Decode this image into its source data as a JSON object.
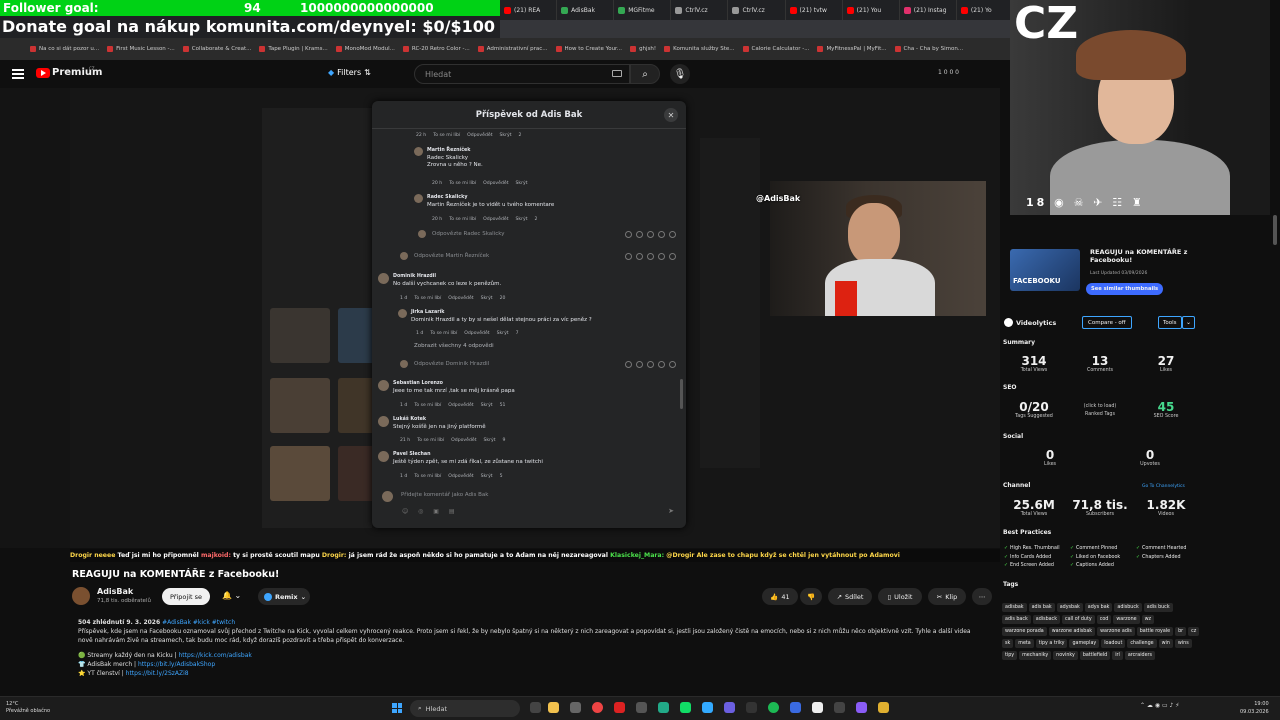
{
  "overlay": {
    "goal_label": "Follower goal:",
    "goal_current": "94",
    "goal_target": "1000000000000000",
    "donate_text": "Donate goal na nákup komunita.com/deynyel: $0/$100",
    "cam_text": "CZ"
  },
  "browser": {
    "tabs": [
      "(21) REA",
      "AdisBak",
      "MGFitme",
      "CtrlV.cz",
      "CtrlV.cz",
      "(21) tvtw",
      "(21) You",
      "(21) Instag",
      "(21) Yo"
    ],
    "tab_colors": [
      "#ff0000",
      "#34a853",
      "#34a853",
      "#999999",
      "#999999",
      "#ff0000",
      "#ff0000",
      "#e1306c",
      "#ff0000"
    ],
    "bookmarks": [
      "Na co si dát pozor u...",
      "First Music Lesson -...",
      "Collaborate & Creat...",
      "Tape Plugin | Krams...",
      "MonoMod Modul...",
      "RC-20 Retro Color -...",
      "Administrativní prac...",
      "How to Create Your...",
      "ghjsh!",
      "Komunita služby Ste...",
      "Calorie Calculator -...",
      "MyFitnessPal | MyFit...",
      "Cha - Cha by Simon..."
    ]
  },
  "yt_header": {
    "brand": "Premium",
    "country": "CZ",
    "filters_label": "Filters",
    "search_placeholder": "Hledat",
    "counts": "1 0 0 0"
  },
  "modal": {
    "title": "Příspěvek od Adis Bak",
    "comments": [
      {
        "meta": [
          "22 h",
          "To se mi líbí",
          "Odpovědět",
          "Skrýt",
          "2"
        ]
      },
      {
        "author": "Martin Řezníček",
        "mention": "Radec Skalicky",
        "text": "Zrovna u něho ? Ne.",
        "meta": [
          "20 h",
          "To se mi líbí",
          "Odpovědět",
          "Skrýt"
        ]
      },
      {
        "author": "Radec Skalicky",
        "text": "Martin Řezníček je to vidět u tvého komentare",
        "meta": [
          "20 h",
          "To se mi líbí",
          "Odpovědět",
          "Skrýt",
          "2"
        ]
      },
      {
        "author": "Dominik Hrazdil",
        "text": "No další vychcanek co leze k penězům.",
        "meta": [
          "1 d",
          "To se mi líbí",
          "Odpovědět",
          "Skrýt",
          "20"
        ]
      },
      {
        "author": "Jirka Lazarík",
        "text": "Dominik Hrazdil a ty by si nešel dělat stejnou práci za víc peněz ?",
        "meta": [
          "1 d",
          "To se mi líbí",
          "Odpovědět",
          "Skrýt",
          "7"
        ]
      },
      {
        "author": "Sebastian Lorenzo",
        "text": "Jeee to me tak mrzí ,tak se měj krásně papa",
        "meta": [
          "1 d",
          "To se mi líbí",
          "Odpovědět",
          "Skrýt",
          "51"
        ]
      },
      {
        "author": "Lukáš Kotek",
        "text": "Stejný košťě jen na jiný platformě",
        "meta": [
          "21 h",
          "To se mi líbí",
          "Odpovědět",
          "Skrýt",
          "9"
        ]
      },
      {
        "author": "Pavel Slechan",
        "text": "Ještě týden zpět, se mi zdá říkal, ze zůstane na twitchi",
        "meta": [
          "1 d",
          "To se mi líbí",
          "Odpovědět",
          "Skrýt",
          "5"
        ]
      }
    ],
    "reply_radec": "Odpovězte Radec Skalicky",
    "reply_martin": "Odpovězte Martin Řezníček",
    "reply_dominik": "Odpovězte Dominik Hrazdil",
    "show_all": "Zobrazit všechny 4 odpovědi",
    "comment_placeholder": "Přidejte komentář jako Adis Bak"
  },
  "cam2": {
    "handle": "@AdisBak"
  },
  "ticker": {
    "parts": [
      {
        "t": "Drogir neeee ",
        "c": "y"
      },
      {
        "t": "Teď jsi mi ho připomněl ",
        "c": ""
      },
      {
        "t": "majkoid: ",
        "c": "r"
      },
      {
        "t": "ty si prostě scoutil mapu ",
        "c": ""
      },
      {
        "t": "Drogir: ",
        "c": "y"
      },
      {
        "t": "já jsem rád že aspoň někdo si ho pamatuje a to Adam na něj nezareagoval ",
        "c": ""
      },
      {
        "t": "Klasickej_Mara: ",
        "c": "g"
      },
      {
        "t": "@Drogir Ale zase to chapu když se chtěl jen vytáhnout po Adamovi",
        "c": "y"
      }
    ]
  },
  "video": {
    "title": "REAGUJU na KOMENTÁŘE z Facebooku!",
    "channel": "AdisBak",
    "subs": "71,8 tis. odběratelů",
    "join": "Připojit se",
    "remix": "Remix",
    "likes": "41",
    "share": "Sdílet",
    "save": "Uložit",
    "clip": "Klip",
    "desc_meta": "504 zhlédnutí  9. 3. 2026",
    "desc_hashtags": "#AdisBak #kick #twitch",
    "desc_text": "Příspěvek, kde jsem na Facebooku oznamoval svůj přechod z Twitche na Kick, vyvolal celkem vyhrocený reakce. Proto jsem si řekl, že by nebylo špatný si na některý z nich zareagovat a popovídat si, jestli jsou založený čistě na emocích, nebo si z nich můžu něco objektivně vzít. Tyhle a další videa nově nahrávám živě na streamech, tak budu moc rád, když dorazíš pozdravit a třeba přispět do konverzace.",
    "desc_l1": "Streamy každý den na Kicku | ",
    "desc_l1_link": "https://kick.com/adisbak",
    "desc_l2": "AdisBak merch | ",
    "desc_l2_link": "https://bit.ly/AdisbakShop",
    "desc_l3": "YT členství | ",
    "desc_l3_link": "https://bit.ly/2SzAZi8"
  },
  "rightpanel": {
    "video_title": "REAGUJU na KOMENTÁŘE z Facebooku!",
    "updated": "Last Updated 03/09/2026",
    "similar": "See similar thumbnails",
    "thumb_text": "FACEBOOKU",
    "vidiq": "Videolytics",
    "compare": "Compare - off",
    "tools": "Tools",
    "summary": "Summary",
    "views": "314",
    "views_l": "Total Views",
    "comments": "13",
    "comments_l": "Comments",
    "likes": "27",
    "likes_l": "Likes",
    "seo": "SEO",
    "tags_sugg": "0/20",
    "tags_sugg_l": "Tags Suggested",
    "ranked": "(click to load)",
    "ranked_l": "Ranked Tags",
    "seo_score": "45",
    "seo_score_l": "SEO Score",
    "social": "Social",
    "fb_likes": "0",
    "fb_likes_l": "Likes",
    "upvotes": "0",
    "upvotes_l": "Upvotes",
    "channel": "Channel",
    "channel_link": "Go To Channelytics",
    "ch_views": "25.6M",
    "ch_views_l": "Total Views",
    "ch_subs": "71,8 tis.",
    "ch_subs_l": "Subscribers",
    "ch_videos": "1.82K",
    "ch_videos_l": "Videos",
    "best": "Best Practices",
    "bp": [
      "High Res. Thumbnail",
      "Comment Pinned",
      "Comment Hearted",
      "Info Cards Added",
      "Liked on Facebook",
      "Chapters Added",
      "End Screen Added",
      "Captions Added"
    ],
    "tags_label": "Tags",
    "tags": [
      "adisbak",
      "adis bak",
      "adysbak",
      "adys bak",
      "adisbuck",
      "adis buck",
      "adis back",
      "adisback",
      "call of duty",
      "cod",
      "warzone",
      "wz",
      "warzone porada",
      "warzone adisbak",
      "warzone adis",
      "battle royale",
      "br",
      "cz",
      "sk",
      "meta",
      "tipy a triky",
      "gameplay",
      "loadout",
      "challenge",
      "win",
      "wins",
      "tipy",
      "mechaniky",
      "novinky",
      "battlefield",
      "irl",
      "arcraiders"
    ]
  },
  "taskbar": {
    "temp": "12°C",
    "weather": "Převážně oblačno",
    "search": "Hledat",
    "time": "19:00",
    "date": "09.03.2026"
  }
}
